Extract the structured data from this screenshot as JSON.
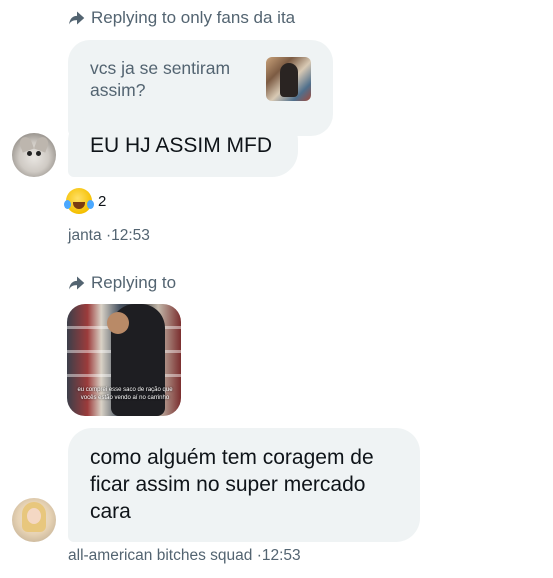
{
  "messages": [
    {
      "reply_label": "Replying to only fans da ita",
      "quoted_text": "vcs ja se sentiram assim?",
      "text": "EU HJ ASSIM MFD",
      "reaction": {
        "emoji": "face-with-tears-of-joy",
        "count": "2"
      },
      "sender": "janta",
      "time": "12:53"
    },
    {
      "reply_label": "Replying to",
      "quoted_image_caption": "eu comprei esse saco de ração que vocês estão vendo aí no carrinho",
      "text": "como alguém tem coragem de ficar assim no super mercado cara",
      "sender": "all-american bitches squad",
      "time": "12:53"
    }
  ],
  "separator": "·",
  "colors": {
    "bubble": "#eff3f4",
    "meta_text": "#536471",
    "text": "#0f1419"
  },
  "icons": {
    "reply": "reply-arrow-icon"
  }
}
